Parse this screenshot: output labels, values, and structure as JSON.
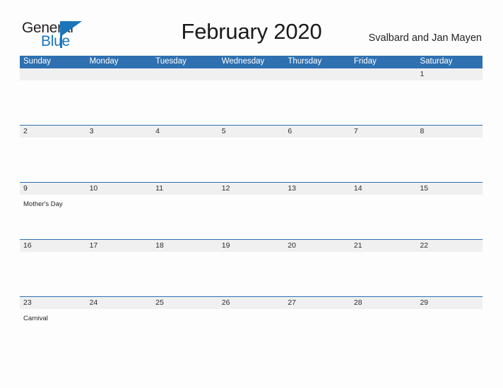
{
  "branding": {
    "logo_primary": "General",
    "logo_secondary": "Blue",
    "logo_accent_color": "#1b75bb",
    "logo_text_color": "#231f20"
  },
  "header": {
    "title": "February 2020",
    "region": "Svalbard and Jan Mayen"
  },
  "calendar": {
    "month": "February",
    "year": "2020",
    "header_color": "#2e70b0",
    "date_band_color": "#f0f0f0",
    "weekday_headers": [
      "Sunday",
      "Monday",
      "Tuesday",
      "Wednesday",
      "Thursday",
      "Friday",
      "Saturday"
    ],
    "weeks": [
      {
        "days": [
          {
            "date": "",
            "event": ""
          },
          {
            "date": "",
            "event": ""
          },
          {
            "date": "",
            "event": ""
          },
          {
            "date": "",
            "event": ""
          },
          {
            "date": "",
            "event": ""
          },
          {
            "date": "",
            "event": ""
          },
          {
            "date": "1",
            "event": ""
          }
        ]
      },
      {
        "days": [
          {
            "date": "2",
            "event": ""
          },
          {
            "date": "3",
            "event": ""
          },
          {
            "date": "4",
            "event": ""
          },
          {
            "date": "5",
            "event": ""
          },
          {
            "date": "6",
            "event": ""
          },
          {
            "date": "7",
            "event": ""
          },
          {
            "date": "8",
            "event": ""
          }
        ]
      },
      {
        "days": [
          {
            "date": "9",
            "event": "Mother's Day"
          },
          {
            "date": "10",
            "event": ""
          },
          {
            "date": "11",
            "event": ""
          },
          {
            "date": "12",
            "event": ""
          },
          {
            "date": "13",
            "event": ""
          },
          {
            "date": "14",
            "event": ""
          },
          {
            "date": "15",
            "event": ""
          }
        ]
      },
      {
        "days": [
          {
            "date": "16",
            "event": ""
          },
          {
            "date": "17",
            "event": ""
          },
          {
            "date": "18",
            "event": ""
          },
          {
            "date": "19",
            "event": ""
          },
          {
            "date": "20",
            "event": ""
          },
          {
            "date": "21",
            "event": ""
          },
          {
            "date": "22",
            "event": ""
          }
        ]
      },
      {
        "days": [
          {
            "date": "23",
            "event": "Carnival"
          },
          {
            "date": "24",
            "event": ""
          },
          {
            "date": "25",
            "event": ""
          },
          {
            "date": "26",
            "event": ""
          },
          {
            "date": "27",
            "event": ""
          },
          {
            "date": "28",
            "event": ""
          },
          {
            "date": "29",
            "event": ""
          }
        ]
      }
    ]
  }
}
